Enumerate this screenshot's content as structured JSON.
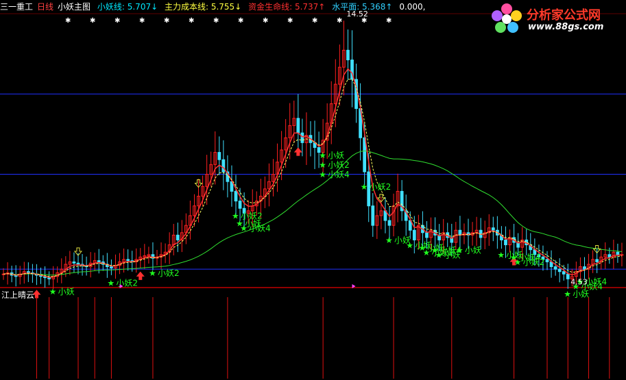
{
  "header": {
    "stock": "三一重工",
    "period": "日线",
    "indicator": "小妖主图",
    "items": [
      {
        "text": "小妖线: 5.707↓",
        "color": "#00e8ff"
      },
      {
        "text": "主力成本线: 5.755↓",
        "color": "#ffff40"
      },
      {
        "text": "资金生命线: 5.737↑",
        "color": "#ff3030"
      },
      {
        "text": "水平面: 5.368↑",
        "color": "#30d0ff"
      },
      {
        "text": "0.000,",
        "color": "#ffffff"
      }
    ]
  },
  "lower_panel_label": "江上晴云",
  "logo": {
    "title": "分析家公式网",
    "url": "www.88gs.com"
  },
  "colors": {
    "up": "#ff2020",
    "down": "#40e0ff",
    "cost_line": "#ffff60",
    "life_line": "#ff3030",
    "long_line": "#30e030",
    "star": "#20ff20",
    "hline": "#2030ff",
    "separator": "#c00000"
  },
  "chart_data": {
    "type": "candlestick",
    "price_labels": [
      {
        "text": "14.52",
        "index": 82
      },
      {
        "text": "4.53",
        "index": 136
      }
    ],
    "star_labels": [
      {
        "text": "小妖",
        "index": 12
      },
      {
        "text": "小妖2",
        "index": 26
      },
      {
        "text": "小妖2",
        "index": 36
      },
      {
        "text": "小妖2",
        "index": 56
      },
      {
        "text": "小妖",
        "index": 57
      },
      {
        "text": "小妖4",
        "index": 58
      },
      {
        "text": "小妖",
        "index": 77
      },
      {
        "text": "小妖2",
        "index": 77
      },
      {
        "text": "小妖4",
        "index": 77
      },
      {
        "text": "小妖2",
        "index": 87
      },
      {
        "text": "小妖",
        "index": 93
      },
      {
        "text": "小妖",
        "index": 98
      },
      {
        "text": "小妖",
        "index": 101
      },
      {
        "text": "小妖",
        "index": 105
      },
      {
        "text": "小妖2",
        "index": 102
      },
      {
        "text": "小妖4",
        "index": 104
      },
      {
        "text": "小妖",
        "index": 110
      },
      {
        "text": "小妖",
        "index": 120
      },
      {
        "text": "小妖4",
        "index": 123
      },
      {
        "text": "小妖2",
        "index": 124
      },
      {
        "text": "小妖",
        "index": 136
      },
      {
        "text": "小妖4",
        "index": 138
      },
      {
        "text": "小妖4",
        "index": 139
      }
    ],
    "closes": [
      4.8,
      4.85,
      4.75,
      4.7,
      4.8,
      4.9,
      4.85,
      4.8,
      4.75,
      4.7,
      4.65,
      4.6,
      4.7,
      4.85,
      5.0,
      5.2,
      5.3,
      5.25,
      5.2,
      5.15,
      5.1,
      5.25,
      5.35,
      5.3,
      5.2,
      5.1,
      5.05,
      5.15,
      5.3,
      5.4,
      5.35,
      5.3,
      5.4,
      5.5,
      5.55,
      5.6,
      5.45,
      5.5,
      5.6,
      5.7,
      6.0,
      6.4,
      6.2,
      6.5,
      6.8,
      7.2,
      7.6,
      8.0,
      8.4,
      8.9,
      9.3,
      9.8,
      9.5,
      9.0,
      8.6,
      8.2,
      7.8,
      7.5,
      7.3,
      7.4,
      7.6,
      7.8,
      8.0,
      8.3,
      8.6,
      8.9,
      9.4,
      9.9,
      10.4,
      10.9,
      11.2,
      10.6,
      10.2,
      10.5,
      10.2,
      10.0,
      9.8,
      10.3,
      11.0,
      11.8,
      12.6,
      13.3,
      14.0,
      13.6,
      12.8,
      11.6,
      10.4,
      9.0,
      7.6,
      6.8,
      7.2,
      7.4,
      7.0,
      6.8,
      7.6,
      8.2,
      7.4,
      7.0,
      6.6,
      6.2,
      6.8,
      6.5,
      6.3,
      6.6,
      6.4,
      6.2,
      6.5,
      6.3,
      6.1,
      6.6,
      6.4,
      6.5,
      6.4,
      6.5,
      6.6,
      6.3,
      6.5,
      6.7,
      6.6,
      6.4,
      6.2,
      6.0,
      6.3,
      6.1,
      5.9,
      6.2,
      6.0,
      5.8,
      5.6,
      5.5,
      5.4,
      5.3,
      5.1,
      5.0,
      4.9,
      4.8,
      4.6,
      4.7,
      4.9,
      5.1,
      5.0,
      5.2,
      5.4,
      5.3,
      5.5,
      5.6,
      5.5,
      5.7,
      5.6,
      5.6
    ],
    "ylim": [
      4.3,
      15.5
    ],
    "horizontal_levels": [
      5.0,
      8.9,
      12.2
    ],
    "signal_indices": [
      8,
      18,
      33,
      47,
      71,
      91,
      123,
      143
    ],
    "lower_panel_bar_indices": [
      8,
      11,
      18,
      22,
      26,
      36,
      54,
      77,
      94,
      108,
      123,
      131,
      136,
      141,
      146
    ]
  }
}
